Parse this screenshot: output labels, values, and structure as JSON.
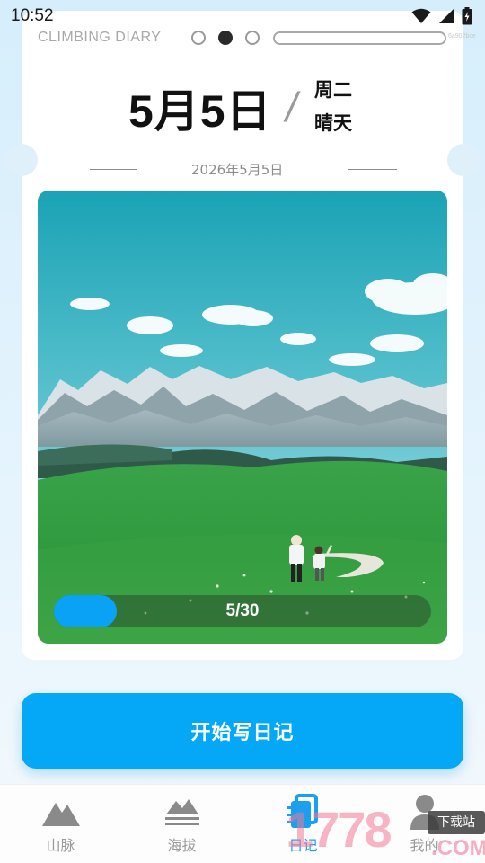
{
  "status_bar": {
    "time": "10:52",
    "icons": [
      "wifi-icon",
      "cellular-signal-icon",
      "battery-charging-icon"
    ]
  },
  "card": {
    "brand": "CLIMBING DIARY",
    "pager": {
      "total": 3,
      "active_index": 1
    },
    "faint_label": "6a902bce",
    "big_date": "5月5日",
    "slash": "/",
    "weekday": "周二",
    "weather": "晴天",
    "full_date": "2026年5月5日",
    "photo": {
      "description_icon": "mountain-landscape-photo"
    },
    "progress": {
      "text": "5/30",
      "current": 5,
      "total": 30
    }
  },
  "cta": {
    "label": "开始写日记"
  },
  "bottom_nav": {
    "active_index": 2,
    "items": [
      {
        "label": "山脉",
        "icon": "mountain-icon"
      },
      {
        "label": "海拔",
        "icon": "altitude-icon"
      },
      {
        "label": "日记",
        "icon": "diary-book-icon"
      },
      {
        "label": "我的",
        "icon": "person-icon"
      }
    ]
  },
  "watermark": {
    "number": "1778",
    "badge": "下载站",
    "suffix": ".COM"
  },
  "colors": {
    "accent": "#05a8f7",
    "nav_active": "#1aa0ee",
    "nav_inactive": "#9a9a9a"
  }
}
